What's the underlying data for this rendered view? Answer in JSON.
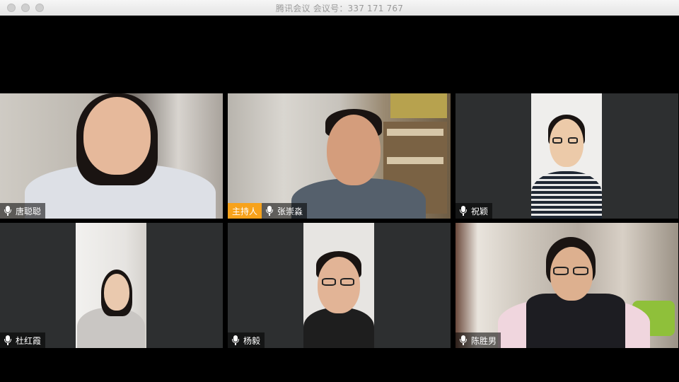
{
  "window": {
    "title": "腾讯会议 会议号：337 171 767"
  },
  "participants": [
    {
      "name": "唐聪聪",
      "host": false
    },
    {
      "name": "张崇淼",
      "host": true,
      "host_label": "主持人"
    },
    {
      "name": "祝颖",
      "host": false
    },
    {
      "name": "杜红霞",
      "host": false
    },
    {
      "name": "杨毅",
      "host": false
    },
    {
      "name": "陈胜男",
      "host": false
    }
  ]
}
